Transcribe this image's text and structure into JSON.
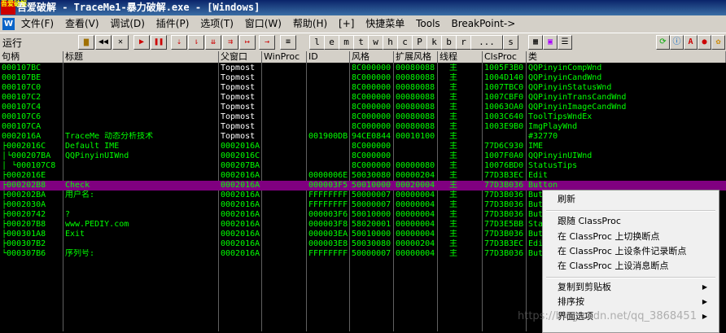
{
  "titlebar": {
    "logo": "吾爱破解",
    "title": "吾爱破解 - TraceMe1-暴力破解.exe - [Windows]"
  },
  "menubar": {
    "app_icon": "W",
    "items": [
      "文件(F)",
      "查看(V)",
      "调试(D)",
      "插件(P)",
      "选项(T)",
      "窗口(W)",
      "帮助(H)",
      "[+]",
      "快捷菜单",
      "Tools",
      "BreakPoint->"
    ]
  },
  "toolbar": {
    "status": "运行",
    "letters": [
      "l",
      "e",
      "m",
      "t",
      "w",
      "h",
      "c",
      "P",
      "k",
      "b",
      "r",
      "...",
      "s"
    ]
  },
  "columns": [
    "句柄",
    "标题",
    "父窗口",
    "WinProc",
    "ID",
    "风格",
    "扩展风格",
    "线程",
    "ClsProc",
    "类"
  ],
  "rows": [
    {
      "h": "000107BC",
      "t": "",
      "p": "Topmost",
      "w": "",
      "i": "",
      "s": "8C000000",
      "e": "00080088",
      "th": "主",
      "c": "1005F3B0",
      "cl": "QQPinyinCompWnd"
    },
    {
      "h": "000107BE",
      "t": "",
      "p": "Topmost",
      "w": "",
      "i": "",
      "s": "8C000000",
      "e": "00080088",
      "th": "主",
      "c": "1004D140",
      "cl": "QQPinyinCandWnd"
    },
    {
      "h": "000107C0",
      "t": "",
      "p": "Topmost",
      "w": "",
      "i": "",
      "s": "8C000000",
      "e": "00080088",
      "th": "主",
      "c": "1007TBC0",
      "cl": "QQPinyinStatusWnd"
    },
    {
      "h": "000107C2",
      "t": "",
      "p": "Topmost",
      "w": "",
      "i": "",
      "s": "8C000000",
      "e": "00080088",
      "th": "主",
      "c": "1007CBF0",
      "cl": "QQPinyinTransCandWnd"
    },
    {
      "h": "000107C4",
      "t": "",
      "p": "Topmost",
      "w": "",
      "i": "",
      "s": "8C000000",
      "e": "00080088",
      "th": "主",
      "c": "10063OA0",
      "cl": "QQPinyinImageCandWnd"
    },
    {
      "h": "000107C6",
      "t": "",
      "p": "Topmost",
      "w": "",
      "i": "",
      "s": "8C000000",
      "e": "00080088",
      "th": "主",
      "c": "1003C640",
      "cl": "ToolTipsWndEx"
    },
    {
      "h": "000107CA",
      "t": "",
      "p": "Topmost",
      "w": "",
      "i": "",
      "s": "8C000000",
      "e": "00080088",
      "th": "主",
      "c": "1003E9B0",
      "cl": "ImgPlayWnd"
    },
    {
      "h": "0002016A",
      "t": "TraceMe 动态分析技术",
      "p": "Topmost",
      "w": "",
      "i": "001900DB",
      "s": "94CE0844",
      "e": "00010100",
      "th": "主",
      "c": "",
      "cl": "#32770"
    },
    {
      "h": "0002016C",
      "t": "Default IME",
      "p": "0002016A",
      "w": "",
      "i": "",
      "s": "8C000000",
      "e": "",
      "th": "主",
      "c": "77D6C930",
      "cl": "IME"
    },
    {
      "h": "000207BA",
      "t": "QQPinyinUIWnd",
      "p": "0002016C",
      "w": "",
      "i": "",
      "s": "8C000000",
      "e": "",
      "th": "主",
      "c": "1007F0A0",
      "cl": "QQPinyinUIWnd"
    },
    {
      "h": "000107C8",
      "t": "",
      "p": "000207BA",
      "w": "",
      "i": "",
      "s": "8C000000",
      "e": "00000080",
      "th": "主",
      "c": "10076BD0",
      "cl": "StatusTips"
    },
    {
      "h": "0002016E",
      "t": "",
      "p": "0002016A",
      "w": "",
      "i": "0000006E",
      "s": "50030080",
      "e": "00000204",
      "th": "主",
      "c": "77D3B3EC",
      "cl": "Edit"
    },
    {
      "h": "000202B8",
      "t": "Check",
      "p": "0002016A",
      "w": "",
      "i": "000003F5",
      "s": "50010000",
      "e": "00020004",
      "th": "主",
      "c": "77D3B036",
      "cl": "Button"
    },
    {
      "h": "000202BA",
      "t": "用户名:",
      "p": "0002016A",
      "w": "",
      "i": "FFFFFFFF",
      "s": "50000007",
      "e": "00000004",
      "th": "主",
      "c": "77D3B036",
      "cl": "But"
    },
    {
      "h": "0002030A",
      "t": "",
      "p": "0002016A",
      "w": "",
      "i": "FFFFFFFF",
      "s": "50000007",
      "e": "00000004",
      "th": "主",
      "c": "77D3B036",
      "cl": "But"
    },
    {
      "h": "00020742",
      "t": "?",
      "p": "0002016A",
      "w": "",
      "i": "000003F6",
      "s": "50010000",
      "e": "00000004",
      "th": "主",
      "c": "77D3B036",
      "cl": "But"
    },
    {
      "h": "000207B8",
      "t": "www.PEDIY.com",
      "p": "0002016A",
      "w": "",
      "i": "000003F8",
      "s": "58020001",
      "e": "00000004",
      "th": "主",
      "c": "77D3E5BB",
      "cl": "Sta"
    },
    {
      "h": "000301A8",
      "t": "Exit",
      "p": "0002016A",
      "w": "",
      "i": "000003EA",
      "s": "50010000",
      "e": "00000004",
      "th": "主",
      "c": "77D3B036",
      "cl": "But"
    },
    {
      "h": "000307B2",
      "t": "",
      "p": "0002016A",
      "w": "",
      "i": "000003E8",
      "s": "50030080",
      "e": "00000204",
      "th": "主",
      "c": "77D3B3EC",
      "cl": "Edi"
    },
    {
      "h": "000307B6",
      "t": "序列号:",
      "p": "0002016A",
      "w": "",
      "i": "FFFFFFFF",
      "s": "50000007",
      "e": "00000004",
      "th": "主",
      "c": "77D3B036",
      "cl": "But"
    }
  ],
  "context_menu": {
    "refresh": "刷新",
    "follow": "跟随 ClassProc",
    "toggle_bp": "在 ClassProc 上切换断点",
    "cond_log_bp": "在 ClassProc 上设条件记录断点",
    "msg_bp": "在 ClassProc 上设消息断点",
    "copy": "复制到剪贴板",
    "sort": "排序按",
    "appearance": "界面选项"
  },
  "watermark": "https://blog.csdn.net/qq_3868451"
}
